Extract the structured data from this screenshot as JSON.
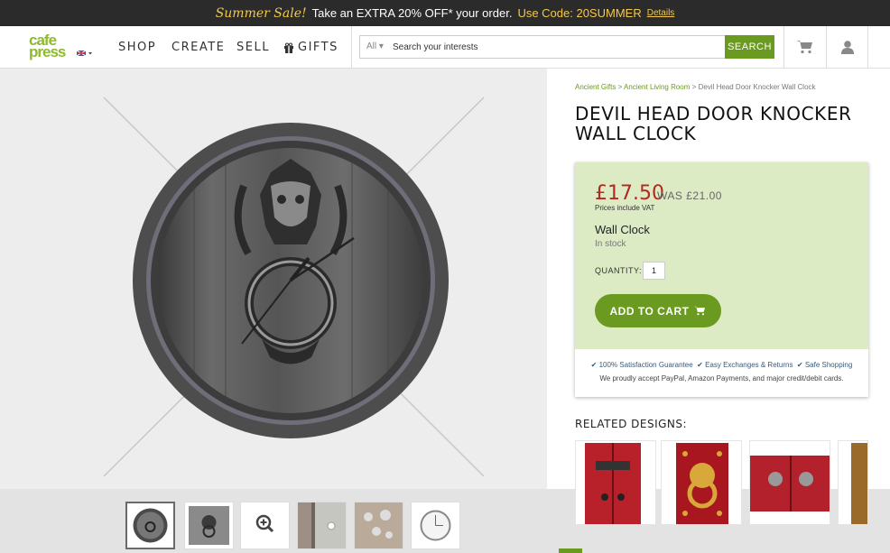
{
  "promo": {
    "sale": "Summer Sale!",
    "message": "Take an EXTRA 20% OFF* your order.",
    "code": "Use Code: 20SUMMER",
    "details": "Details"
  },
  "nav": {
    "logo_top": "cafe",
    "logo_bottom": "press",
    "links": [
      "SHOP",
      "CREATE",
      "SELL",
      "GIFTS"
    ],
    "search_scope": "All",
    "search_placeholder": "Search your interests",
    "search_button": "SEARCH"
  },
  "breadcrumb": {
    "items": [
      "Ancient Gifts",
      "Ancient Living Room",
      "Devil Head Door Knocker Wall Clock"
    ],
    "separator": ">"
  },
  "product": {
    "title": "DEVIL HEAD DOOR KNOCKER WALL CLOCK",
    "price": "£17.50",
    "was": "WAS £21.00",
    "vat": "Prices include VAT",
    "type": "Wall Clock",
    "stock": "In stock",
    "quantity_label": "QUANTITY:",
    "quantity": "1",
    "add_to_cart": "ADD TO CART",
    "guarantees": [
      "100% Satisfaction Guarantee",
      "Easy Exchanges & Returns",
      "Safe Shopping"
    ],
    "payment_note": "We proudly accept PayPal, Amazon Payments, and major credit/debit cards."
  },
  "related": {
    "heading": "RELATED DESIGNS:"
  },
  "colors": {
    "accent": "#6a9a1f",
    "price": "#b22a1f",
    "buybox": "#ddebc4",
    "promo_bg": "#2b2b2b"
  },
  "icons": [
    "gift-icon",
    "cart-icon",
    "user-icon",
    "zoom-icon",
    "check-icon"
  ]
}
